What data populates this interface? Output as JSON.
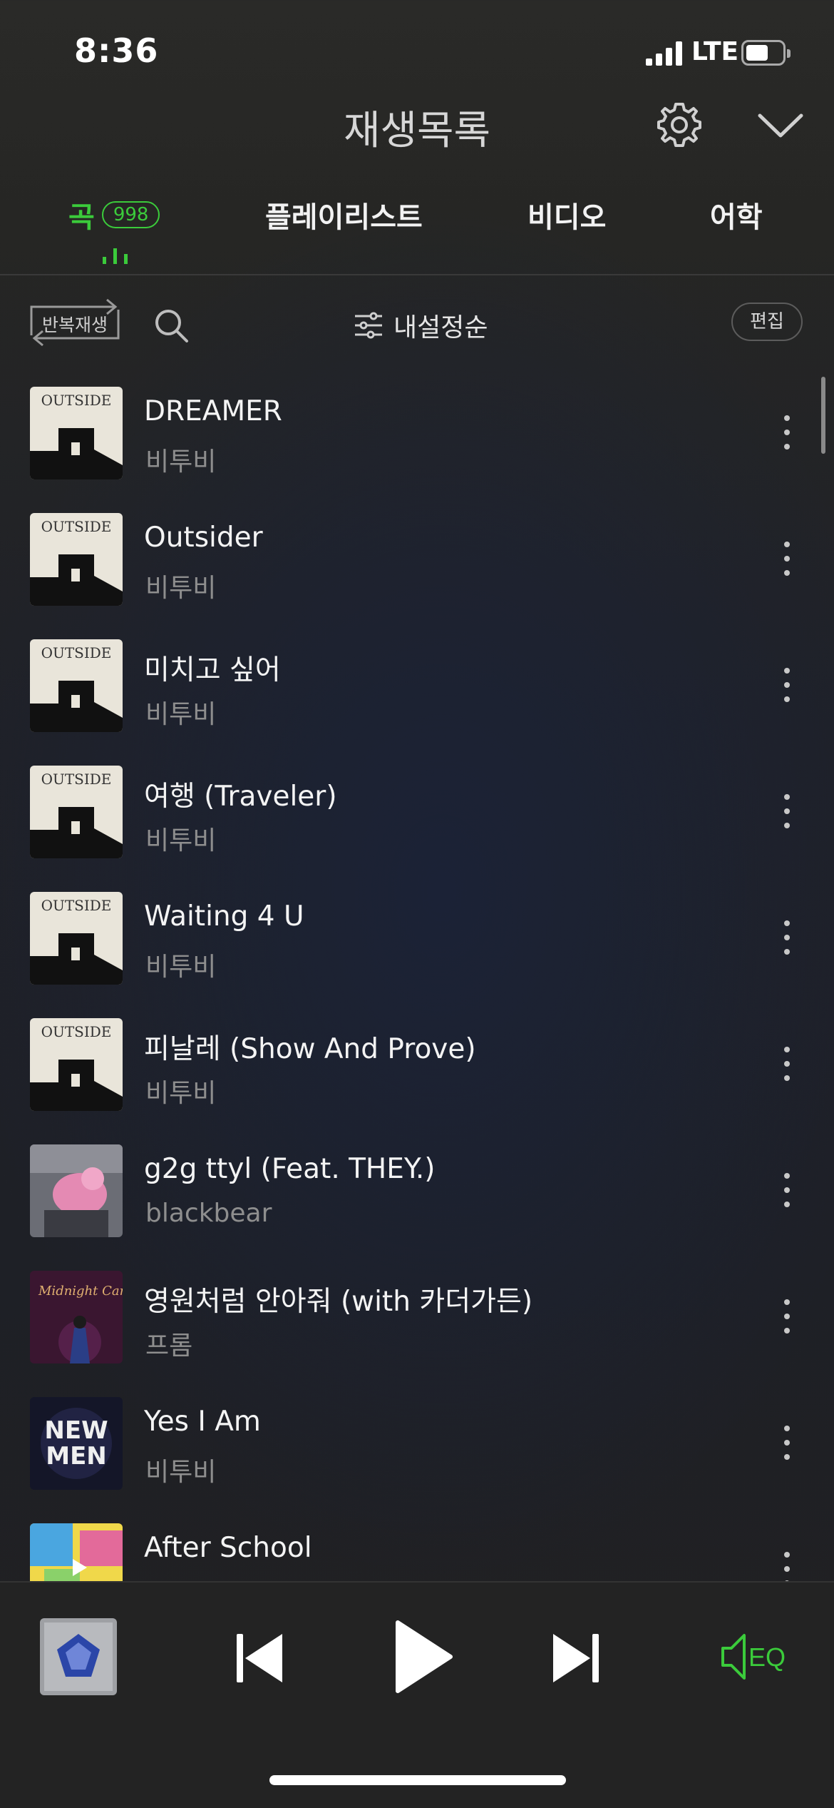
{
  "status_bar": {
    "time": "8:36",
    "network": "LTE"
  },
  "header": {
    "title": "재생목록"
  },
  "tabs": [
    {
      "label": "곡",
      "count": "998"
    },
    {
      "label": "플레이리스트"
    },
    {
      "label": "비디오"
    },
    {
      "label": "어학"
    }
  ],
  "toolbar": {
    "repeat_label": "반복재생",
    "sort_label": "내설정순",
    "edit_label": "편집"
  },
  "songs": [
    {
      "title": "DREAMER",
      "artist": "비투비",
      "art": "outside-album"
    },
    {
      "title": "Outsider",
      "artist": "비투비",
      "art": "outside-album"
    },
    {
      "title": "미치고 싶어",
      "artist": "비투비",
      "art": "outside-album"
    },
    {
      "title": "여행 (Traveler)",
      "artist": "비투비",
      "art": "outside-album"
    },
    {
      "title": "Waiting 4 U",
      "artist": "비투비",
      "art": "outside-album"
    },
    {
      "title": "피날레 (Show And Prove)",
      "artist": "비투비",
      "art": "outside-album"
    },
    {
      "title": "g2g ttyl (Feat. THEY.)",
      "artist": "blackbear",
      "art": "pink-figure-album"
    },
    {
      "title": "영원처럼 안아줘 (with 카더가든)",
      "artist": "프롬",
      "art": "midnight-candy-album"
    },
    {
      "title": "Yes I Am",
      "artist": "비투비",
      "art": "new-men-album"
    },
    {
      "title": "After School",
      "artist": "",
      "art": "colorful-album"
    }
  ],
  "album_text": {
    "outside": "OUTSIDE",
    "midnight": "Midnight Candy",
    "newmen_1": "NEW",
    "newmen_2": "MEN"
  },
  "player": {
    "eq_label": "EQ"
  },
  "colors": {
    "accent": "#3bcb3b",
    "background": "#1f2128",
    "text_secondary": "#8e8e8e"
  }
}
